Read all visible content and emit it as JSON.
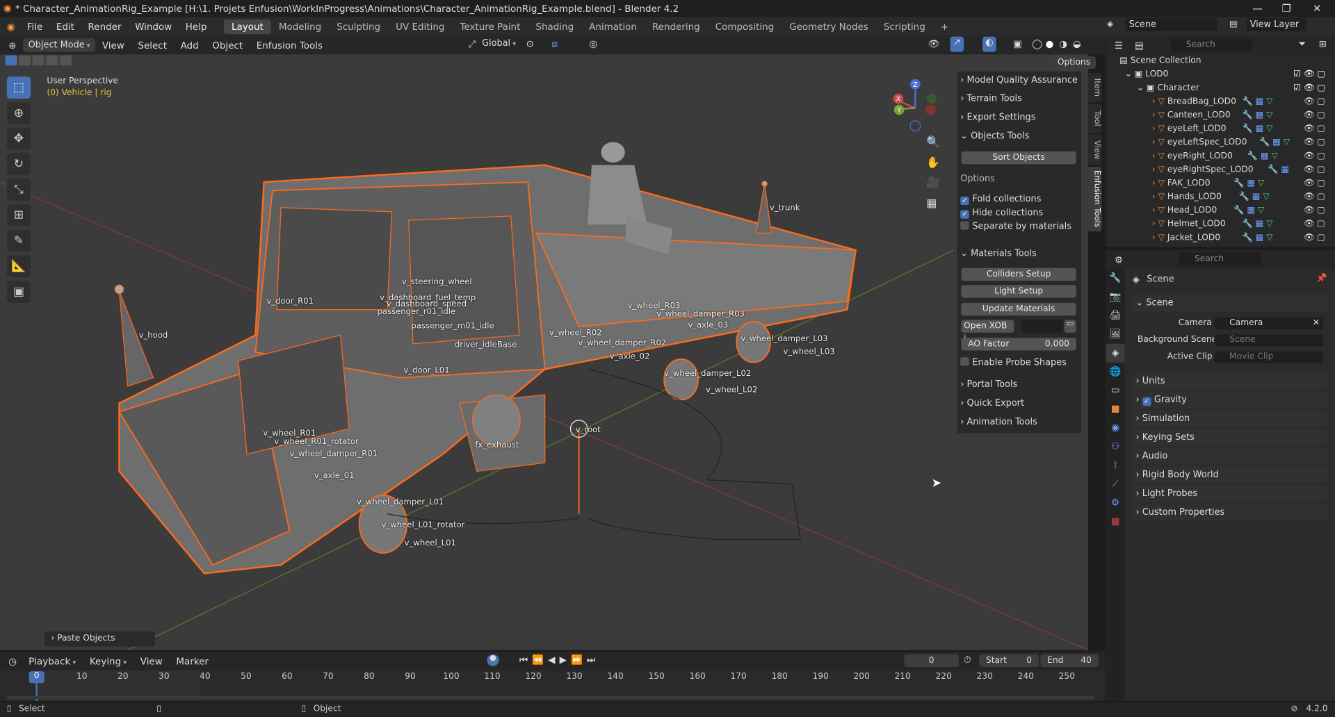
{
  "window": {
    "title": "* Character_AnimationRig_Example [H:\\1. Projets Enfusion\\WorkInProgress\\Animations\\Character_AnimationRig_Example.blend] - Blender 4.2",
    "minimize": "—",
    "maximize": "❐",
    "close": "✕"
  },
  "menubar": {
    "items": [
      "File",
      "Edit",
      "Render",
      "Window",
      "Help"
    ],
    "workspaces": [
      "Layout",
      "Modeling",
      "Sculpting",
      "UV Editing",
      "Texture Paint",
      "Shading",
      "Animation",
      "Rendering",
      "Compositing",
      "Geometry Nodes",
      "Scripting"
    ],
    "add_workspace": "+",
    "scene_label": "Scene",
    "view_layer_label": "View Layer"
  },
  "viewport_header": {
    "mode": "Object Mode",
    "menus": [
      "View",
      "Select",
      "Add",
      "Object",
      "Enfusion Tools"
    ],
    "transform": "Global",
    "options": "Options"
  },
  "viewport": {
    "perspective": "User Perspective",
    "context": "(0) Vehicle | rig",
    "paste_panel": "Paste Objects",
    "gizmo": {
      "x": "X",
      "y": "Y",
      "z": "Z"
    },
    "labels": [
      "v_trunk",
      "v_steering_wheel",
      "v_dashboard_fuel_temp",
      "v_dashboard_speed",
      "passenger_r01_idle",
      "passenger_m01_idle",
      "v_door_R01",
      "v_hood",
      "driver_idleBase",
      "v_door_L01",
      "v_wheel_R03",
      "v_wheel_damper_R03",
      "v_axle_03",
      "v_wheel_R02",
      "v_wheel_damper_R02",
      "v_axle_02",
      "v_wheel_damper_L03",
      "v_wheel_L03",
      "v_wheel_damper_L02",
      "v_wheel_L02",
      "v_wheel_R01",
      "v_wheel_R01_rotator",
      "v_wheel_damper_R01",
      "fx_exhaust",
      "v_root",
      "v_axle_01",
      "v_wheel_damper_L01",
      "v_wheel_L01_rotator",
      "v_wheel_L01"
    ]
  },
  "npanel": {
    "tabs": [
      "Item",
      "Tool",
      "View",
      "Enfusion Tools"
    ],
    "sections": {
      "model_quality": "Model Quality Assurance",
      "terrain": "Terrain Tools",
      "export": "Export Settings",
      "objects": "Objects Tools",
      "materials": "Materials Tools",
      "portal": "Portal Tools",
      "quick_export": "Quick Export",
      "animation": "Animation Tools"
    },
    "sort_objects": "Sort Objects",
    "options_label": "Options",
    "fold_collections": "Fold collections",
    "hide_collections": "Hide collections",
    "separate_materials": "Separate by materials",
    "colliders_setup": "Colliders Setup",
    "light_setup": "Light Setup",
    "update_materials": "Update Materials",
    "open_xob": "Open XOB i...",
    "ao_factor_label": "AO Factor",
    "ao_factor_value": "0.000",
    "enable_probe": "Enable Probe Shapes"
  },
  "outliner": {
    "search_placeholder": "Search",
    "scene_collection": "Scene Collection",
    "lod0": "LOD0",
    "character": "Character",
    "objects": [
      "BreadBag_LOD0",
      "Canteen_LOD0",
      "eyeLeft_LOD0",
      "eyeLeftSpec_LOD0",
      "eyeRight_LOD0",
      "eyeRightSpec_LOD0",
      "FAK_LOD0",
      "Hands_LOD0",
      "Head_LOD0",
      "Helmet_LOD0",
      "Jacket_LOD0"
    ]
  },
  "properties": {
    "search_placeholder": "Search",
    "context": "Scene",
    "panel_scene": "Scene",
    "camera_label": "Camera",
    "camera_value": "Camera",
    "bg_scene_label": "Background Scene",
    "bg_scene_placeholder": "Scene",
    "active_clip_label": "Active Clip",
    "active_clip_placeholder": "Movie Clip",
    "sections": [
      "Units",
      "Gravity",
      "Simulation",
      "Keying Sets",
      "Audio",
      "Rigid Body World",
      "Light Probes",
      "Custom Properties"
    ]
  },
  "timeline": {
    "menus": [
      "Playback",
      "Keying",
      "View",
      "Marker"
    ],
    "current_frame": "0",
    "start_label": "Start",
    "start": "0",
    "end_label": "End",
    "end": "40",
    "ticks": [
      "0",
      "10",
      "20",
      "30",
      "40",
      "50",
      "60",
      "70",
      "80",
      "90",
      "100",
      "110",
      "120",
      "130",
      "140",
      "150",
      "160",
      "170",
      "180",
      "190",
      "200",
      "210",
      "220",
      "230",
      "240",
      "250"
    ]
  },
  "statusbar": {
    "select": "Select",
    "object": "Object",
    "version": "4.2.0"
  },
  "colors": {
    "selection_outline": "#ff6a1a",
    "active_tab": "#4772b3",
    "x_axis": "#c84a4a",
    "y_axis": "#7aa33a"
  }
}
